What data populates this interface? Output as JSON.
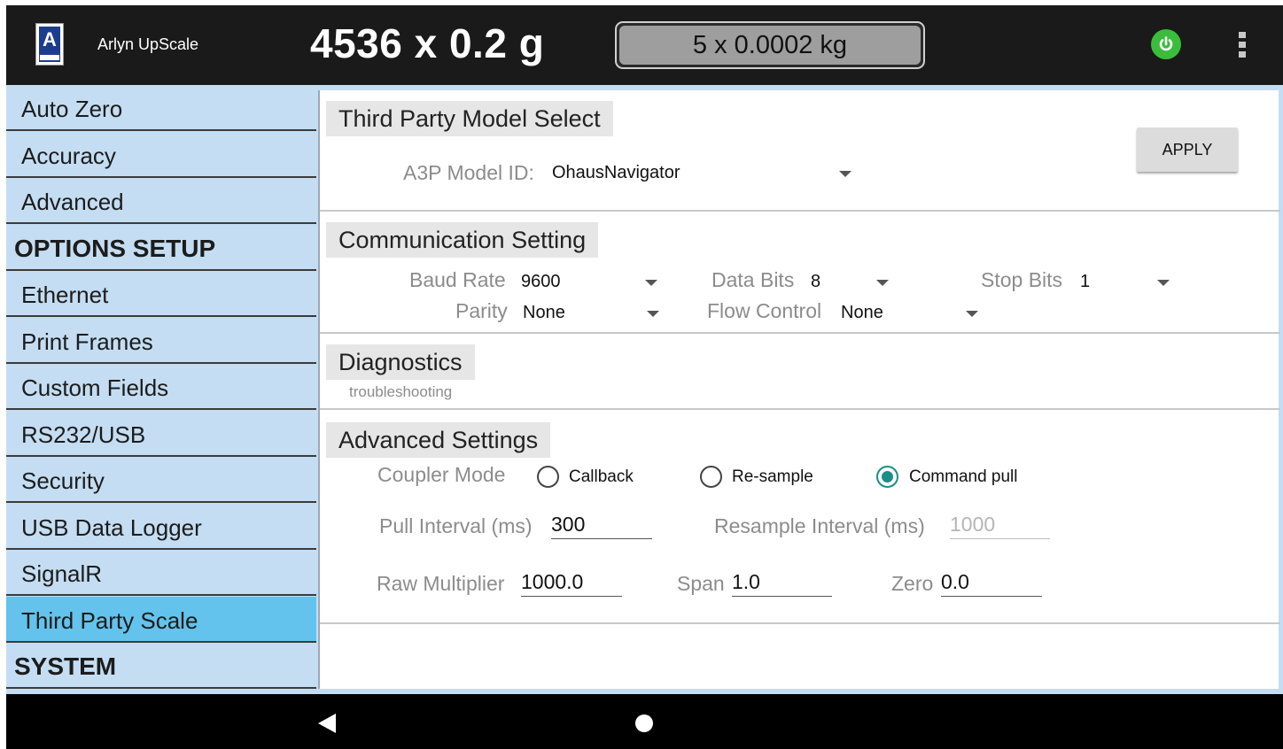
{
  "header": {
    "app_name": "Arlyn UpScale",
    "weight_main": "4536 x 0.2 g",
    "weight_alt": "5 x 0.0002 kg",
    "power_color": "#3bbd3b"
  },
  "sidebar": {
    "items": [
      {
        "label": "Auto Zero",
        "type": "item"
      },
      {
        "label": "Accuracy",
        "type": "item"
      },
      {
        "label": "Advanced",
        "type": "item"
      },
      {
        "label": "OPTIONS SETUP",
        "type": "header"
      },
      {
        "label": "Ethernet",
        "type": "item"
      },
      {
        "label": "Print Frames",
        "type": "item"
      },
      {
        "label": "Custom Fields",
        "type": "item"
      },
      {
        "label": "RS232/USB",
        "type": "item"
      },
      {
        "label": "Security",
        "type": "item"
      },
      {
        "label": "USB Data Logger",
        "type": "item"
      },
      {
        "label": "SignalR",
        "type": "item"
      },
      {
        "label": "Third Party Scale",
        "type": "item",
        "active": true
      },
      {
        "label": "SYSTEM",
        "type": "header"
      }
    ],
    "active_color": "#63c3ec",
    "bg_color": "#c4ddf2"
  },
  "model_select": {
    "title": "Third Party Model Select",
    "model_id_label": "A3P Model ID:",
    "model_id_value": "OhausNavigator",
    "apply_label": "APPLY"
  },
  "communication": {
    "title": "Communication Setting",
    "baud_rate_label": "Baud Rate",
    "baud_rate_value": "9600",
    "data_bits_label": "Data Bits",
    "data_bits_value": "8",
    "stop_bits_label": "Stop Bits",
    "stop_bits_value": "1",
    "parity_label": "Parity",
    "parity_value": "None",
    "flow_control_label": "Flow Control",
    "flow_control_value": "None"
  },
  "diagnostics": {
    "title": "Diagnostics",
    "subtitle": "troubleshooting"
  },
  "advanced_settings": {
    "title": "Advanced Settings",
    "coupler_mode_label": "Coupler Mode",
    "coupler_options": [
      "Callback",
      "Re-sample",
      "Command pull"
    ],
    "coupler_selected": "Command pull",
    "pull_interval_label": "Pull Interval (ms)",
    "pull_interval_value": "300",
    "resample_interval_label": "Resample Interval (ms)",
    "resample_interval_value": "1000",
    "raw_multiplier_label": "Raw Multiplier",
    "raw_multiplier_value": "1000.0",
    "span_label": "Span",
    "span_value": "1.0",
    "zero_label": "Zero",
    "zero_value": "0.0",
    "radio_color": "#1a8f87"
  }
}
